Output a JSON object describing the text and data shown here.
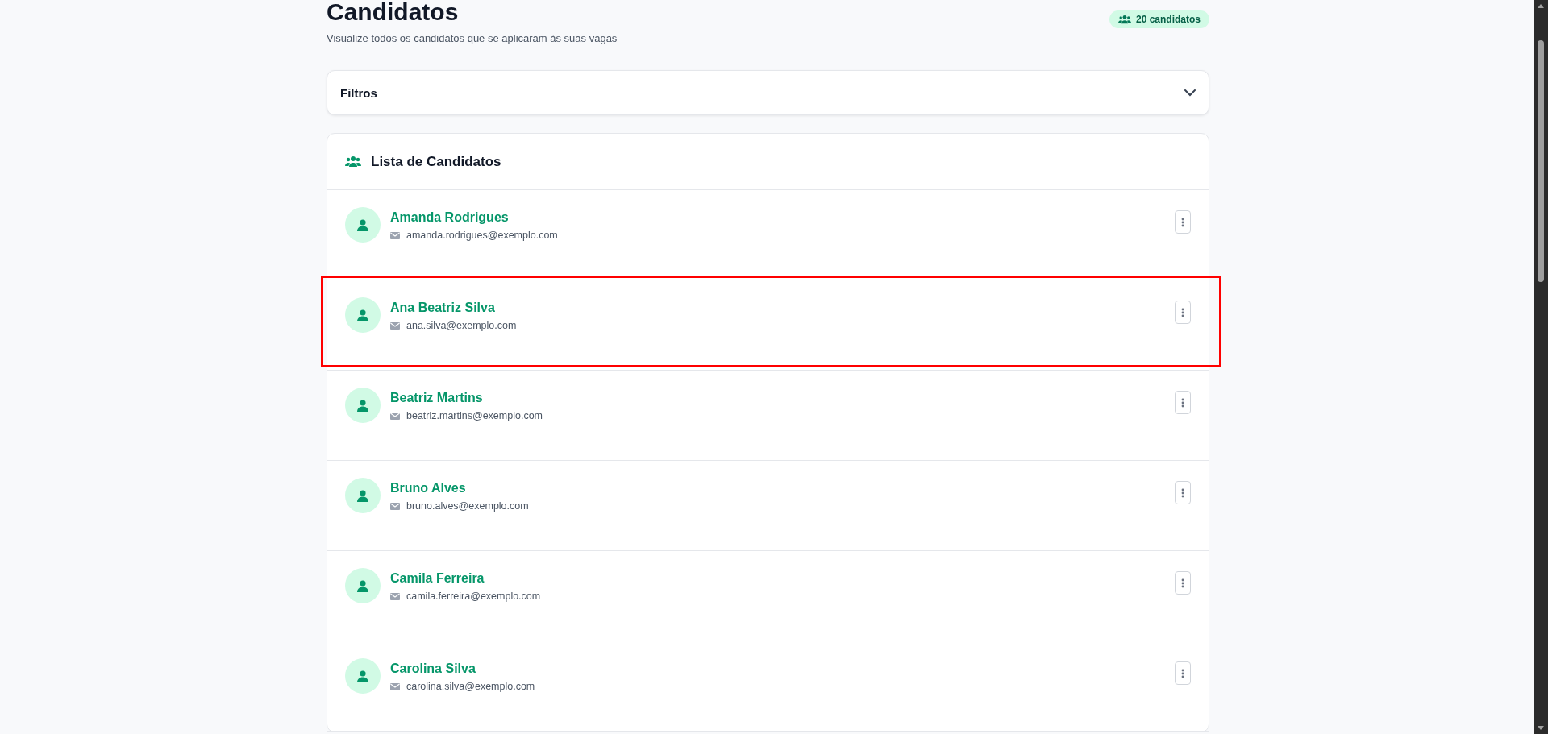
{
  "header": {
    "title": "Candidatos",
    "subtitle": "Visualize todos os candidatos que se aplicaram às suas vagas",
    "count_badge": "20 candidatos"
  },
  "filters": {
    "label": "Filtros",
    "expanded": false
  },
  "list": {
    "title": "Lista de Candidatos",
    "candidates": [
      {
        "name": "Amanda Rodrigues",
        "email": "amanda.rodrigues@exemplo.com",
        "highlighted": false
      },
      {
        "name": "Ana Beatriz Silva",
        "email": "ana.silva@exemplo.com",
        "highlighted": true
      },
      {
        "name": "Beatriz Martins",
        "email": "beatriz.martins@exemplo.com",
        "highlighted": false
      },
      {
        "name": "Bruno Alves",
        "email": "bruno.alves@exemplo.com",
        "highlighted": false
      },
      {
        "name": "Camila Ferreira",
        "email": "camila.ferreira@exemplo.com",
        "highlighted": false
      },
      {
        "name": "Carolina Silva",
        "email": "carolina.silva@exemplo.com",
        "highlighted": false
      }
    ]
  }
}
